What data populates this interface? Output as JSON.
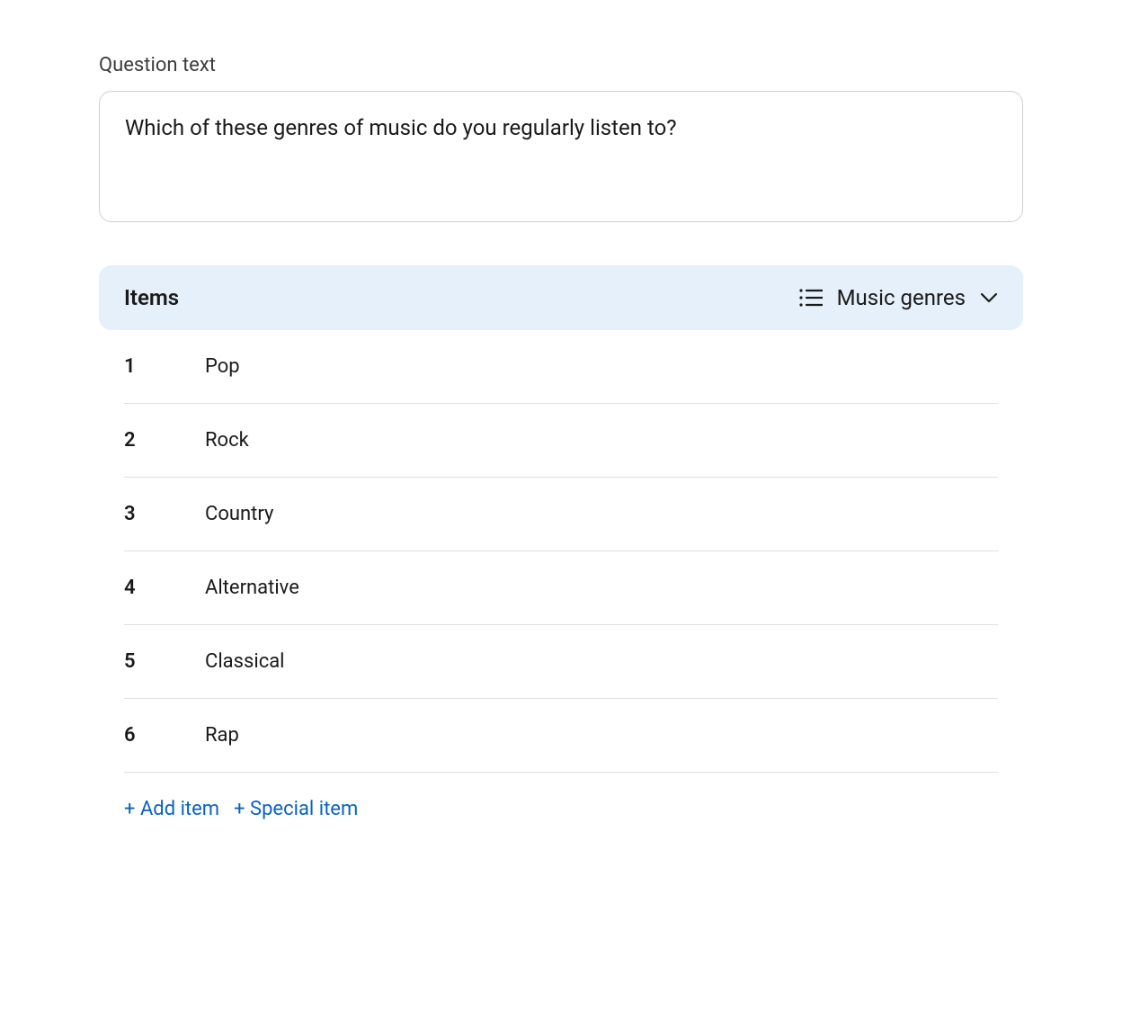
{
  "question": {
    "label": "Question text",
    "text": "Which of these genres of music do you regularly listen to?"
  },
  "items": {
    "header_label": "Items",
    "selector_label": "Music genres",
    "list": [
      {
        "number": "1",
        "label": "Pop"
      },
      {
        "number": "2",
        "label": "Rock"
      },
      {
        "number": "3",
        "label": "Country"
      },
      {
        "number": "4",
        "label": "Alternative"
      },
      {
        "number": "5",
        "label": "Classical"
      },
      {
        "number": "6",
        "label": "Rap"
      }
    ]
  },
  "actions": {
    "add_item": "+ Add item",
    "special_item": "+ Special item"
  },
  "colors": {
    "accent": "#0a63c2",
    "header_bg": "#e5f0fb",
    "border": "#d0d0d0",
    "row_border": "#e0e0e0"
  }
}
